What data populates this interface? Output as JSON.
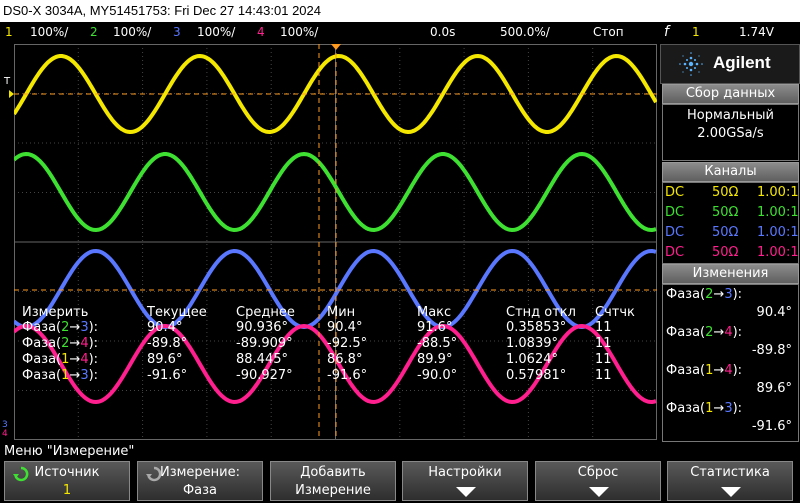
{
  "title": "DS0-X 3034A, MY51451753: Fri Dec 27 14:43:01 2024",
  "colors": {
    "ch1": "#f4e700",
    "ch2": "#3ee031",
    "ch3": "#5a78ff",
    "ch4": "#ff1f8e",
    "trigger": "#ff9a1f"
  },
  "channels_bar": [
    {
      "num": "1",
      "scale": "100%/"
    },
    {
      "num": "2",
      "scale": "100%/"
    },
    {
      "num": "3",
      "scale": "100%/"
    },
    {
      "num": "4",
      "scale": "100%/"
    }
  ],
  "timebar": {
    "delay": "0.0s",
    "timebase": "500.0%/",
    "run_state": "Стоп",
    "trigger_symbol": "f",
    "trigger_channel": "1",
    "trigger_level": "1.74V"
  },
  "brand": "Agilent",
  "acquisition": {
    "header": "Сбор данных",
    "mode": "Нормальный",
    "rate": "2.00GSa/s"
  },
  "channels_panel": {
    "header": "Каналы",
    "rows": [
      {
        "coupling": "DC",
        "impedance": "50Ω",
        "probe": "1.00:1"
      },
      {
        "coupling": "DC",
        "impedance": "50Ω",
        "probe": "1.00:1"
      },
      {
        "coupling": "DC",
        "impedance": "50Ω",
        "probe": "1.00:1"
      },
      {
        "coupling": "DC",
        "impedance": "50Ω",
        "probe": "1.00:1"
      }
    ]
  },
  "measurements_panel": {
    "header": "Изменения",
    "items": [
      {
        "label": "Фаза",
        "from": "2",
        "to": "3",
        "value": "90.4°"
      },
      {
        "label": "Фаза",
        "from": "2",
        "to": "4",
        "value": "-89.8°"
      },
      {
        "label": "Фаза",
        "from": "1",
        "to": "4",
        "value": "89.6°"
      },
      {
        "label": "Фаза",
        "from": "1",
        "to": "3",
        "value": "-91.6°"
      }
    ]
  },
  "stats_table": {
    "headers": [
      "Измерить",
      "Текущее",
      "Среднее",
      "Мин",
      "Макс",
      "Стнд откл",
      "Счтчк"
    ],
    "rows": [
      {
        "label": "Фаза",
        "from": "2",
        "to": "3",
        "cur": "90.4°",
        "mean": "90.936°",
        "min": "90.4°",
        "max": "91.6°",
        "std": "0.35853°",
        "count": "11"
      },
      {
        "label": "Фаза",
        "from": "2",
        "to": "4",
        "cur": "-89.8°",
        "mean": "-89.909°",
        "min": "-92.5°",
        "max": "-88.5°",
        "std": "1.0839°",
        "count": "11"
      },
      {
        "label": "Фаза",
        "from": "1",
        "to": "4",
        "cur": "89.6°",
        "mean": "88.445°",
        "min": "86.8°",
        "max": "89.9°",
        "std": "1.0624°",
        "count": "11"
      },
      {
        "label": "Фаза",
        "from": "1",
        "to": "3",
        "cur": "-91.6°",
        "mean": "-90.927°",
        "min": "-91.6°",
        "max": "-90.0°",
        "std": "0.57981°",
        "count": "11"
      }
    ]
  },
  "menu_title": "Меню \"Измерение\"",
  "softkeys": [
    {
      "l1": "Источник",
      "l2": "1",
      "icon": "rotate-knob-icon"
    },
    {
      "l1": "Измерение:",
      "l2": "Фаза",
      "icon": "rotate-knob-icon"
    },
    {
      "l1": "Добавить",
      "l2": "Измерение",
      "icon": ""
    },
    {
      "l1": "Настройки",
      "l2": "",
      "icon": "submenu-arrow-icon"
    },
    {
      "l1": "Сброс",
      "l2": "",
      "icon": "submenu-arrow-icon"
    },
    {
      "l1": "Статистика",
      "l2": "",
      "icon": "submenu-arrow-icon"
    }
  ],
  "arrow": "→",
  "trigger_marker": "T",
  "ground_markers": [
    "3",
    "4"
  ]
}
